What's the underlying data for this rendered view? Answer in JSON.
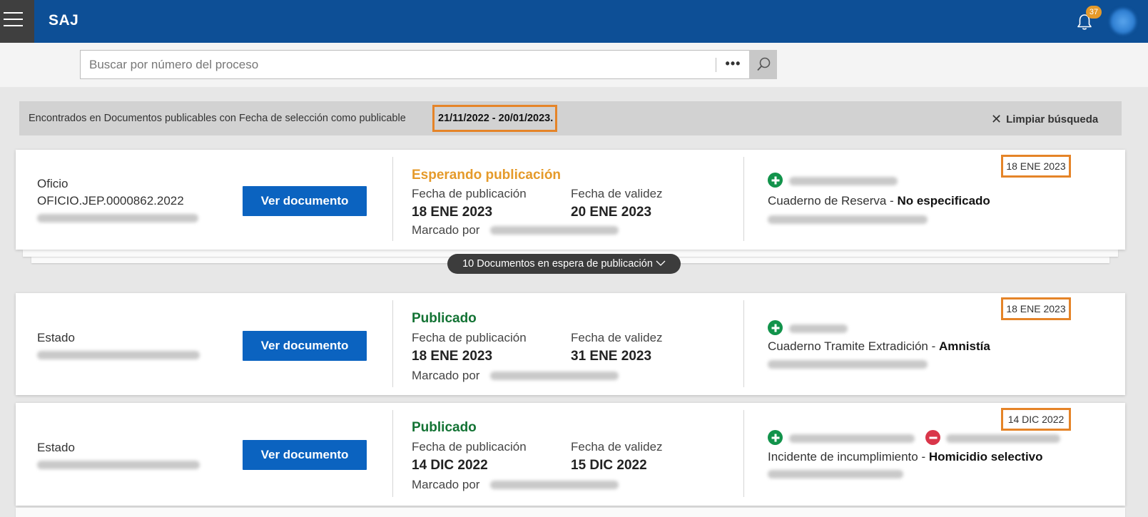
{
  "app": {
    "title": "SAJ",
    "notifications_count": "37"
  },
  "search": {
    "placeholder": "Buscar por número del proceso",
    "more_label": "•••"
  },
  "filter": {
    "text": "Encontrados en Documentos publicables con Fecha de selección como publicable",
    "range": "21/11/2022 - 20/01/2023",
    "period": ".",
    "clear_label": "Limpiar búsqueda"
  },
  "labels": {
    "ver_documento": "Ver documento",
    "fecha_publicacion": "Fecha de publicación",
    "fecha_validez": "Fecha de validez",
    "marcado_por": "Marcado por",
    "separator": " - "
  },
  "group_toggle": {
    "label": "10 Documentos en espera de publicación"
  },
  "cards": [
    {
      "doc_type": "Oficio",
      "doc_id": "OFICIO.JEP.0000862.2022",
      "status": "Esperando publicación",
      "fecha_publicacion": "18 ENE 2023",
      "fecha_validez": "20 ENE 2023",
      "date_badge": "18 ENE 2023",
      "cuaderno": "Cuaderno de Reserva",
      "cuaderno_value": "No especificado"
    },
    {
      "doc_type": "Estado",
      "status": "Publicado",
      "fecha_publicacion": "18 ENE 2023",
      "fecha_validez": "31 ENE 2023",
      "date_badge": "18 ENE 2023",
      "cuaderno": "Cuaderno Tramite Extradición",
      "cuaderno_value": "Amnistía"
    },
    {
      "doc_type": "Estado",
      "status": "Publicado",
      "fecha_publicacion": "14 DIC 2022",
      "fecha_validez": "15 DIC 2022",
      "date_badge": "14 DIC 2022",
      "cuaderno": "Incidente de incumplimiento",
      "cuaderno_value": "Homicidio selectivo"
    }
  ],
  "colors": {
    "topbar": "#0d4f96",
    "button": "#0b63c0",
    "waiting": "#e59a2a",
    "published": "#137334",
    "highlight": "#e58428",
    "plus": "#12934b",
    "minus": "#d9364a"
  },
  "icons": [
    "menu-icon",
    "bell-icon",
    "search-icon",
    "close-icon",
    "chevron-down-icon",
    "plus-circle-icon",
    "minus-circle-icon"
  ]
}
